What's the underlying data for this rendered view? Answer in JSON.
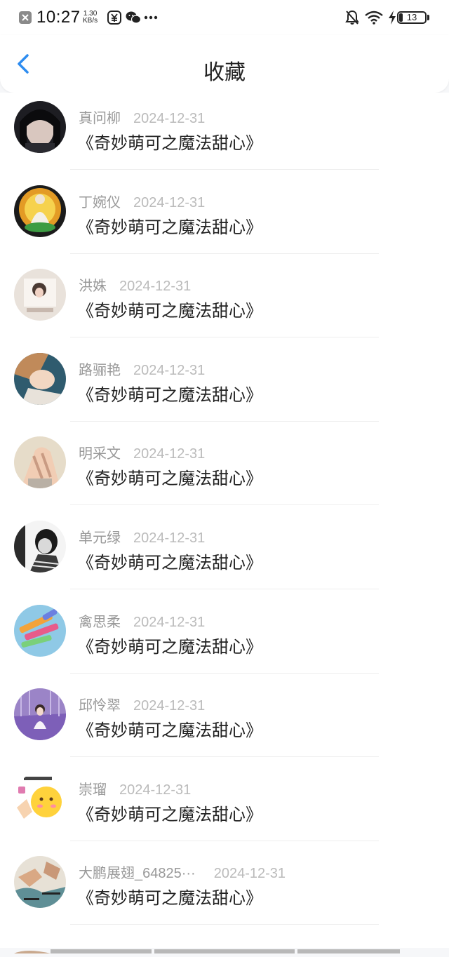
{
  "status": {
    "time": "10:27",
    "speed_value": "1.30",
    "speed_unit": "KB/s",
    "battery": "13"
  },
  "header": {
    "title": "收藏"
  },
  "items": [
    {
      "name": "真问柳",
      "date": "2024-12-31",
      "book": "《奇妙萌可之魔法甜心》"
    },
    {
      "name": "丁婉仪",
      "date": "2024-12-31",
      "book": "《奇妙萌可之魔法甜心》"
    },
    {
      "name": "洪姝",
      "date": "2024-12-31",
      "book": "《奇妙萌可之魔法甜心》"
    },
    {
      "name": "路骊艳",
      "date": "2024-12-31",
      "book": "《奇妙萌可之魔法甜心》"
    },
    {
      "name": "明采文",
      "date": "2024-12-31",
      "book": "《奇妙萌可之魔法甜心》"
    },
    {
      "name": "单元绿",
      "date": "2024-12-31",
      "book": "《奇妙萌可之魔法甜心》"
    },
    {
      "name": "禽思柔",
      "date": "2024-12-31",
      "book": "《奇妙萌可之魔法甜心》"
    },
    {
      "name": "邱怜翠",
      "date": "2024-12-31",
      "book": "《奇妙萌可之魔法甜心》"
    },
    {
      "name": "崇瑠",
      "date": "2024-12-31",
      "book": "《奇妙萌可之魔法甜心》"
    },
    {
      "name": "大鹏展翅_64825···",
      "date": "2024-12-31",
      "book": "《奇妙萌可之魔法甜心》"
    }
  ]
}
